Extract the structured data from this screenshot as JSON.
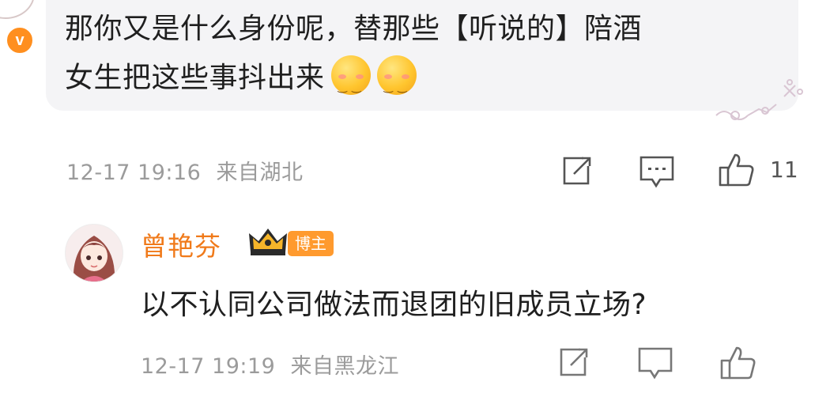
{
  "comment": {
    "text_line1": "那你又是什么身份呢，替那些【听说的】陪酒",
    "text_line2": "女生把这些事抖出来",
    "emojis": [
      "smile-emoji",
      "smile-emoji"
    ],
    "timestamp": "12-17 19:16",
    "location": "来自湖北",
    "like_count": "11",
    "verified_badge": "v",
    "accent_color": "#ff8f1f"
  },
  "reply": {
    "username": "曾艳芬",
    "host_tag": "博主",
    "text": "以不认同公司做法而退团的旧成员立场?",
    "timestamp": "12-17 19:19",
    "location": "来自黑龙江",
    "username_color": "#f07a1a"
  },
  "icons": [
    "share-icon",
    "comment-icon",
    "like-icon"
  ]
}
